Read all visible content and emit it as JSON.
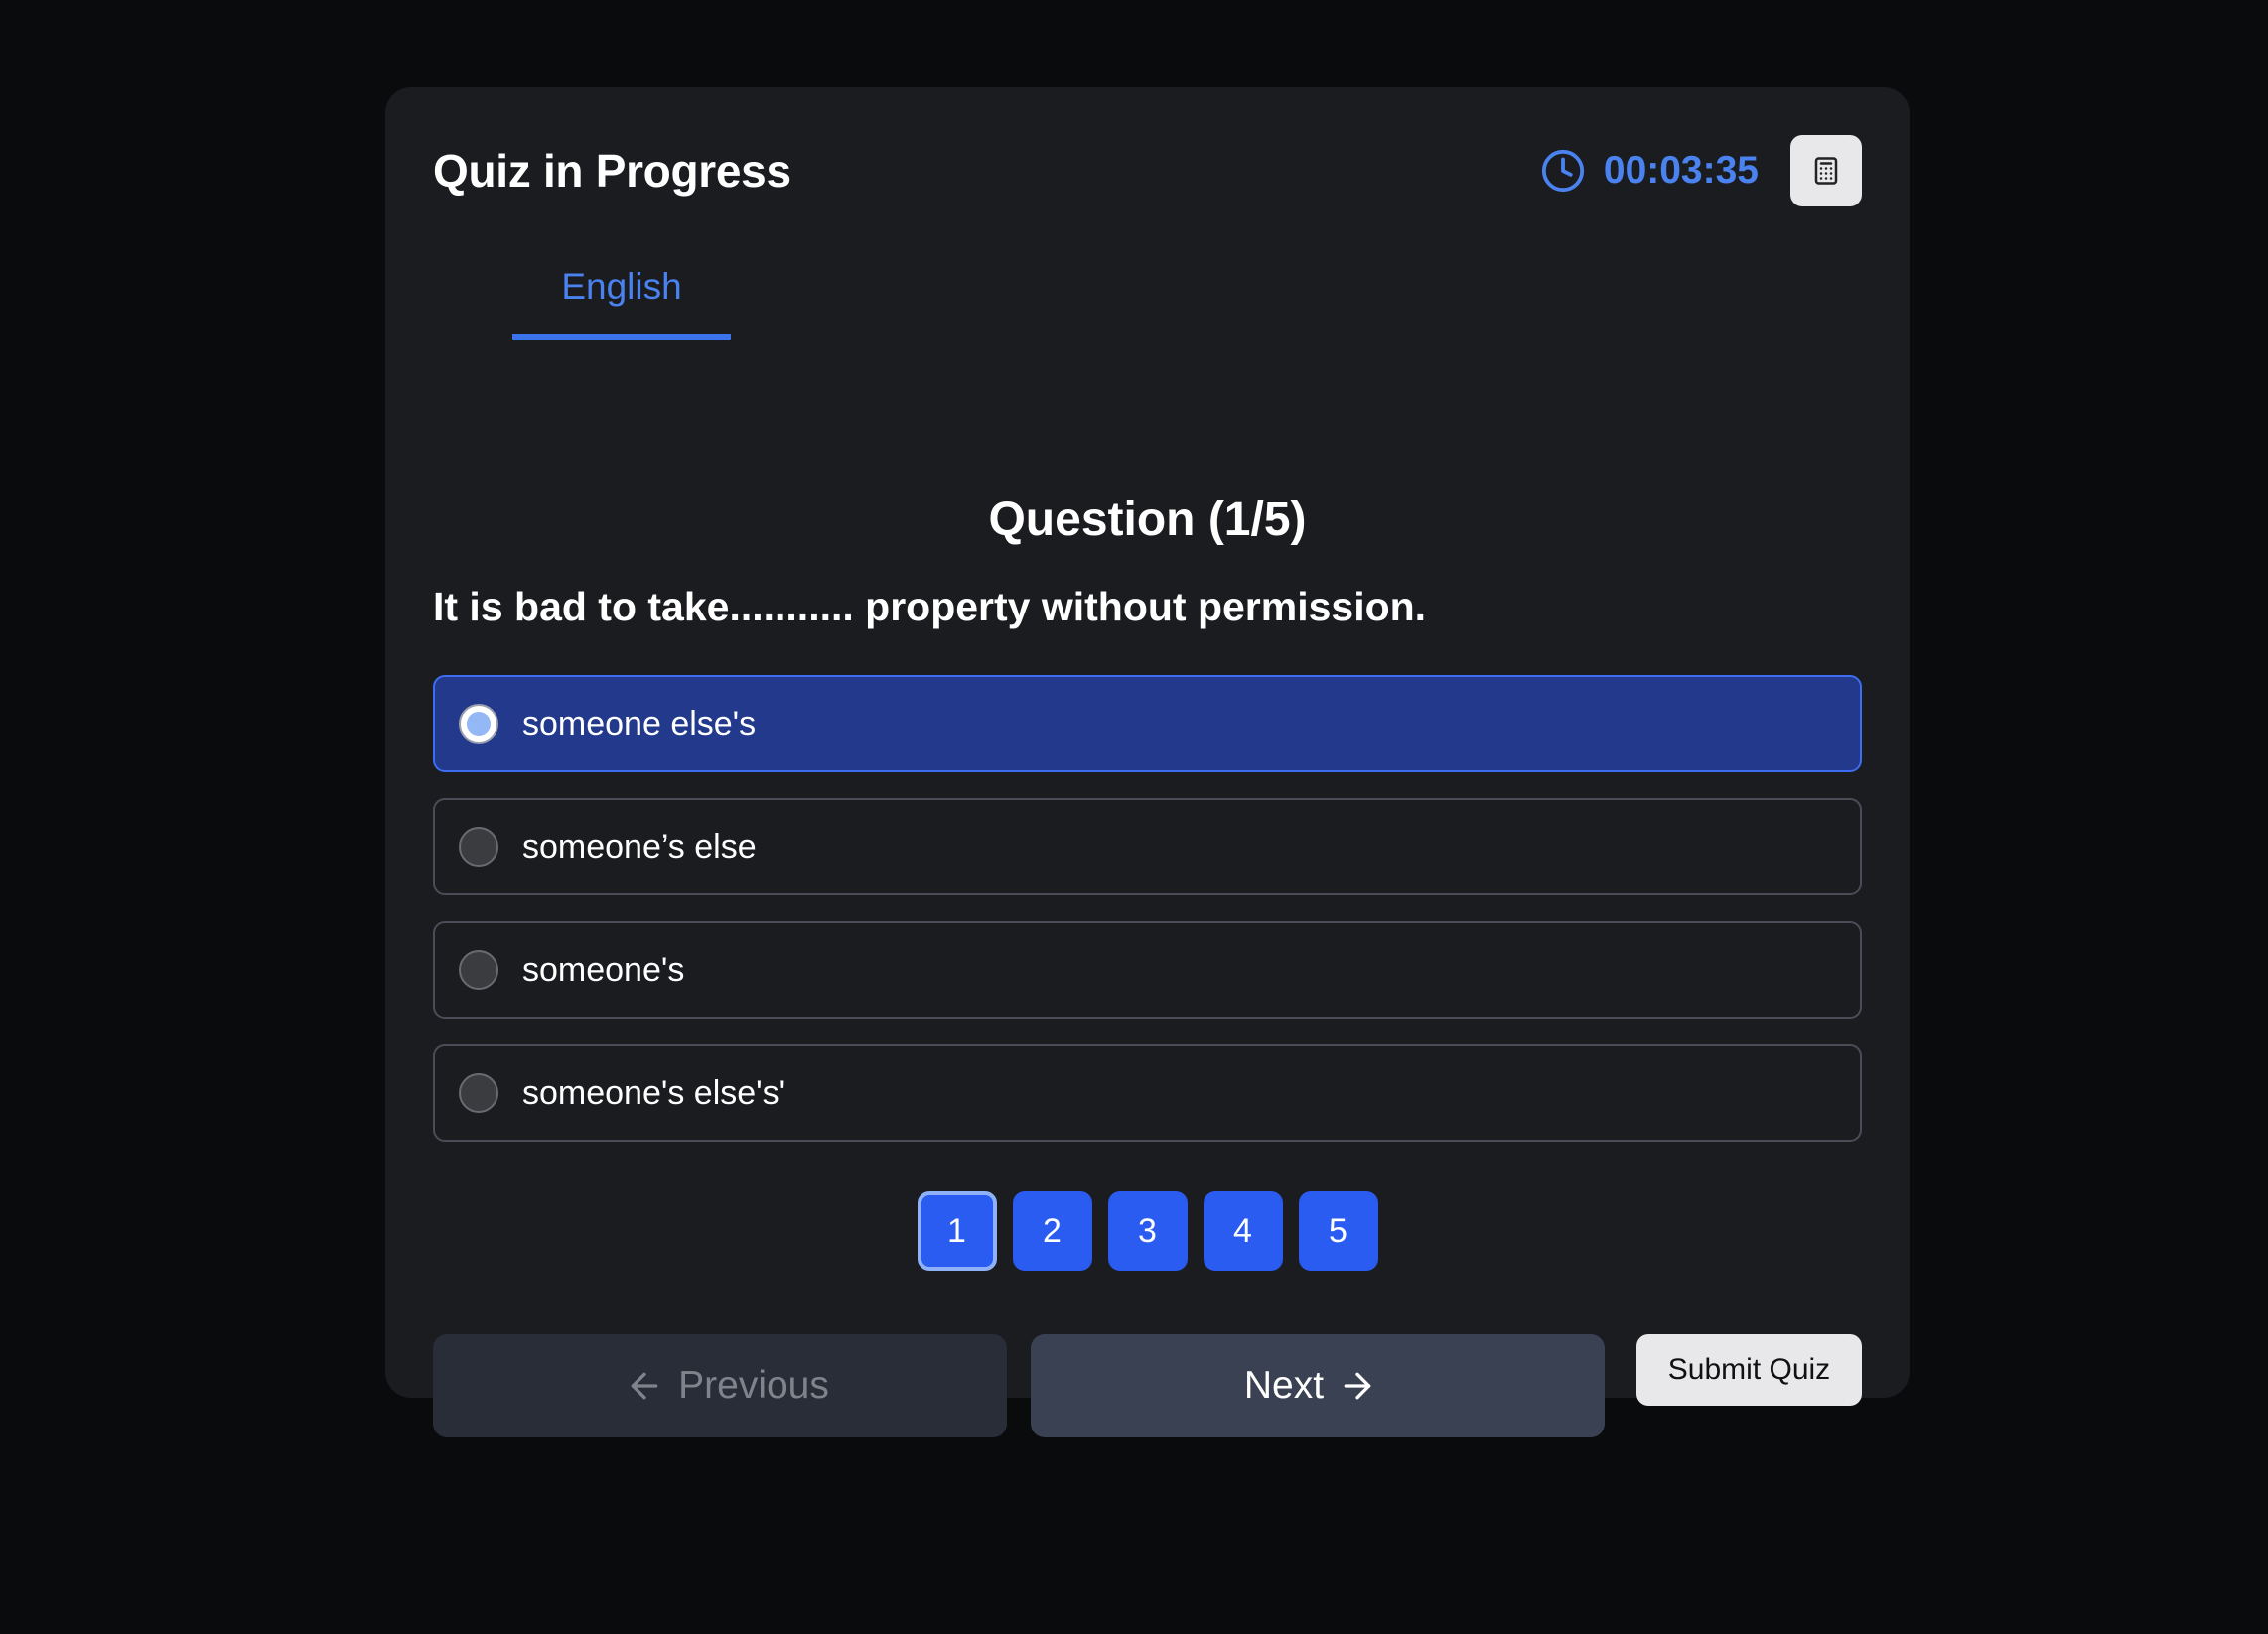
{
  "header": {
    "title": "Quiz in Progress",
    "timer": "00:03:35",
    "timer_icon": "clock-icon",
    "calculator_icon": "calculator-icon"
  },
  "tabs": [
    {
      "label": "English",
      "active": true
    }
  ],
  "question": {
    "heading": "Question (1/5)",
    "text": "It is bad to take........... property without permission.",
    "options": [
      {
        "label": "someone else's",
        "selected": true
      },
      {
        "label": "someone’s else",
        "selected": false
      },
      {
        "label": "someone's",
        "selected": false
      },
      {
        "label": "someone's else's'",
        "selected": false
      }
    ]
  },
  "pagination": {
    "pages": [
      "1",
      "2",
      "3",
      "4",
      "5"
    ],
    "current": "1"
  },
  "navigation": {
    "previous_label": "Previous",
    "next_label": "Next",
    "submit_label": "Submit Quiz",
    "previous_icon": "arrow-left-icon",
    "next_icon": "arrow-right-icon"
  },
  "colors": {
    "background": "#0a0b0d",
    "card": "#1b1c20",
    "accent": "#4a82ef",
    "selected_option": "#233a8c",
    "page_button": "#2a5cf1"
  }
}
